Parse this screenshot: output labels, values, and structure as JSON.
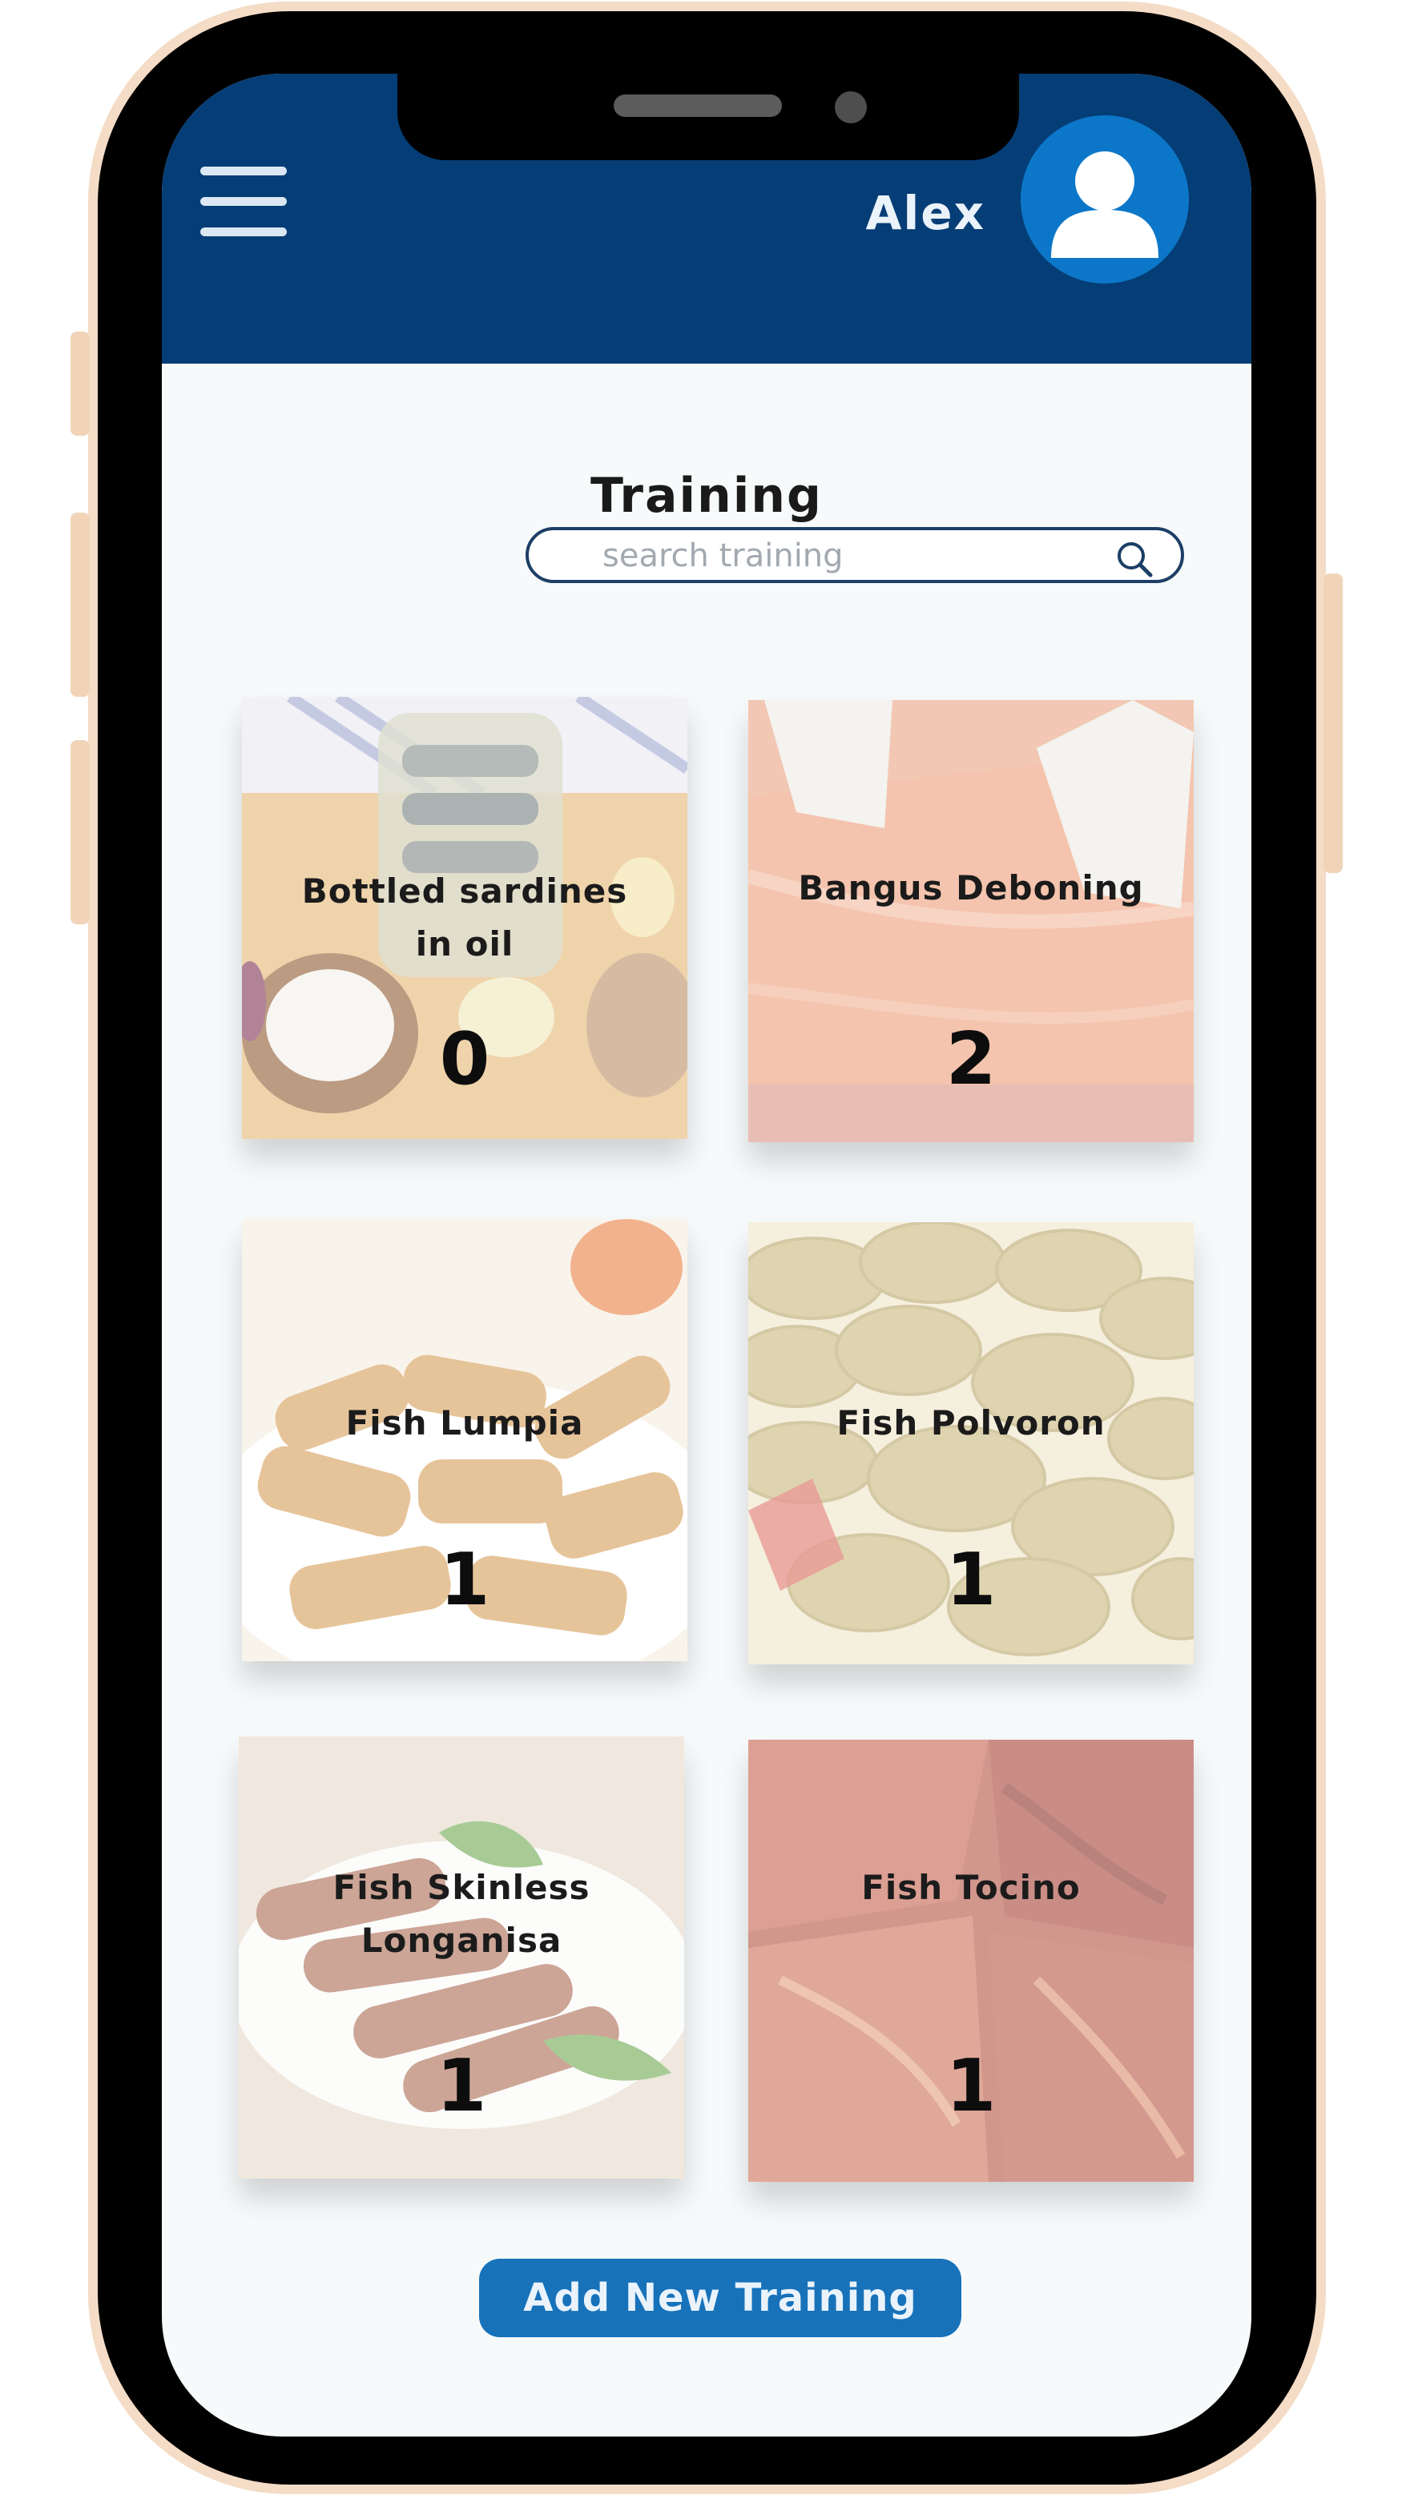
{
  "header": {
    "user_name": "Alex",
    "menu_icon": "hamburger-menu-icon",
    "avatar_icon": "user-avatar-icon"
  },
  "page": {
    "title": "Training"
  },
  "search": {
    "placeholder": "search training",
    "value": "",
    "icon": "search-icon"
  },
  "trainings": [
    {
      "title": "Bottled sardines\nin oil",
      "count": "0",
      "image": "bottled-sardines-photo"
    },
    {
      "title": "Bangus Deboning",
      "count": "2",
      "image": "bangus-deboning-photo"
    },
    {
      "title": "Fish Lumpia",
      "count": "1",
      "image": "fish-lumpia-photo"
    },
    {
      "title": "Fish Polvoron",
      "count": "1",
      "image": "fish-polvoron-photo"
    },
    {
      "title": "Fish Skinless\nLonganisa",
      "count": "1",
      "image": "fish-longanisa-photo"
    },
    {
      "title": "Fish Tocino",
      "count": "1",
      "image": "fish-tocino-photo"
    }
  ],
  "actions": {
    "add_label": "Add New Training"
  },
  "colors": {
    "header_bg": "#053d76",
    "accent_button": "#1772ba",
    "avatar_bg": "#0c77c8",
    "frame": "#f4dcc6"
  }
}
